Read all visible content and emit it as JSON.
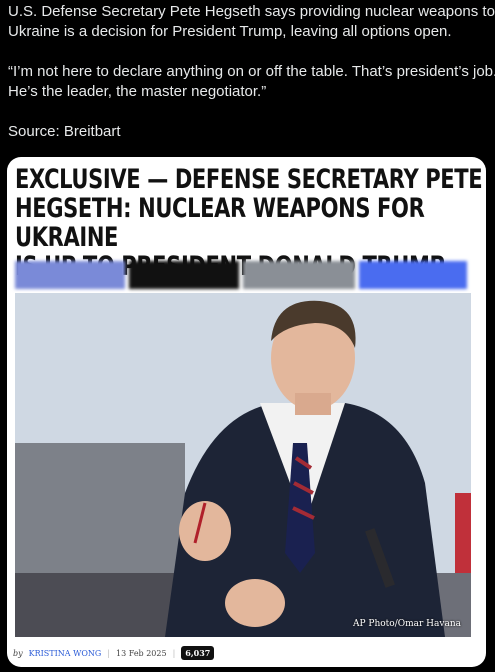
{
  "post": {
    "line1": "U.S. Defense Secretary Pete Hegseth says providing nuclear weapons to",
    "line2": "Ukraine is a decision for President Trump, leaving all options open.",
    "quote1": "“I’m not here to declare anything on or off the table. That’s president’s job.",
    "quote2": "He’s the leader, the master negotiator.”",
    "source": "Source: Breitbart"
  },
  "article": {
    "headline_1": "EXCLUSIVE — DEFENSE SECRETARY PETE",
    "headline_2": "HEGSETH: NUCLEAR WEAPONS FOR UKRAINE",
    "headline_3": "IS UP TO PRESIDENT DONALD TRUMP",
    "photo_credit": "AP Photo/Omar Havana",
    "byline_prefix": "by",
    "author": "KRISTINA WONG",
    "date": "13 Feb 2025",
    "share_count": "6,037"
  },
  "colors": {
    "strip": [
      "#7a8ad8",
      "#111111",
      "#8a8f96",
      "#4a6cf0"
    ]
  }
}
